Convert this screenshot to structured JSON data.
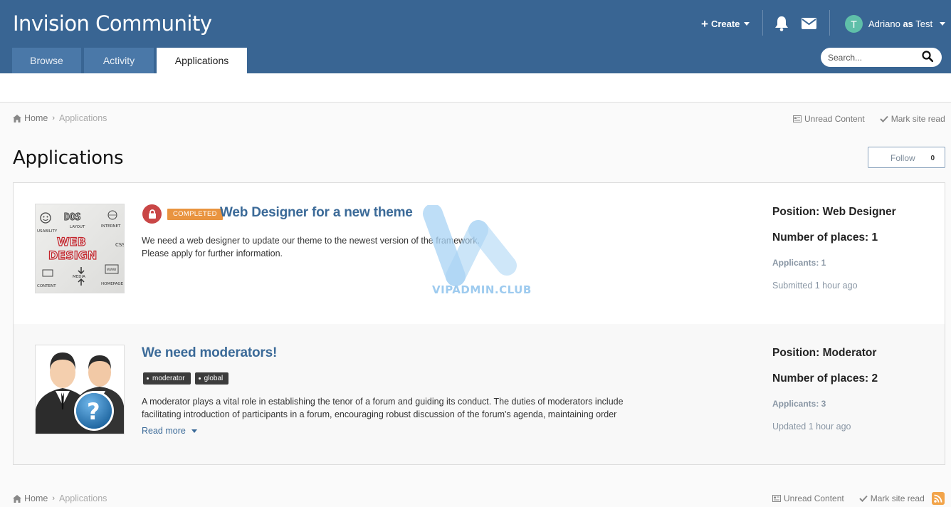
{
  "header": {
    "site_title": "Invision Community",
    "create_label": "Create",
    "user": {
      "initial": "T",
      "name": "Adriano",
      "as_word": "as",
      "target": "Test"
    },
    "search_placeholder": "Search...",
    "tabs": [
      {
        "label": "Browse",
        "active": false
      },
      {
        "label": "Activity",
        "active": false
      },
      {
        "label": "Applications",
        "active": true
      }
    ]
  },
  "breadcrumb": {
    "home": "Home",
    "current": "Applications"
  },
  "actions": {
    "unread": "Unread Content",
    "mark_read": "Mark site read"
  },
  "page": {
    "title": "Applications",
    "follow_label": "Follow",
    "follow_count": "0"
  },
  "items": [
    {
      "badge": "COMPLETED",
      "title": "Web Designer for a new theme",
      "description_lines": [
        "We need a web designer to update our theme to the newest version of the framework.",
        "Please apply for further information."
      ],
      "position": "Position: Web Designer",
      "places": "Number of places: 1",
      "applicants": "Applicants: 1",
      "time": "Submitted 1 hour ago",
      "thumb_words": [
        "WEB",
        "DESIGN",
        "DOS",
        "LAYOUT",
        "INTERNET",
        "USABILITY",
        "CSS",
        "MEDIA",
        "CONTENT",
        "HOMEPAGE",
        "WWW"
      ]
    },
    {
      "title": "We need moderators!",
      "tags": [
        "moderator",
        "global"
      ],
      "description_lines": [
        "A moderator plays a vital role in establishing the tenor of a forum and guiding its conduct. The duties of moderators include",
        "facilitating introduction of participants in a forum, encouraging robust discussion of the forum's agenda, maintaining order"
      ],
      "read_more": "Read more",
      "position": "Position: Moderator",
      "places": "Number of places: 2",
      "applicants": "Applicants: 3",
      "time": "Updated 1 hour ago"
    }
  ],
  "watermark": "VIPADMIN.CLUB",
  "colors": {
    "header": "#396593",
    "link": "#3b6a98",
    "completed": "#e99440",
    "lock": "#c94646",
    "avatar": "#5fbfa9"
  }
}
